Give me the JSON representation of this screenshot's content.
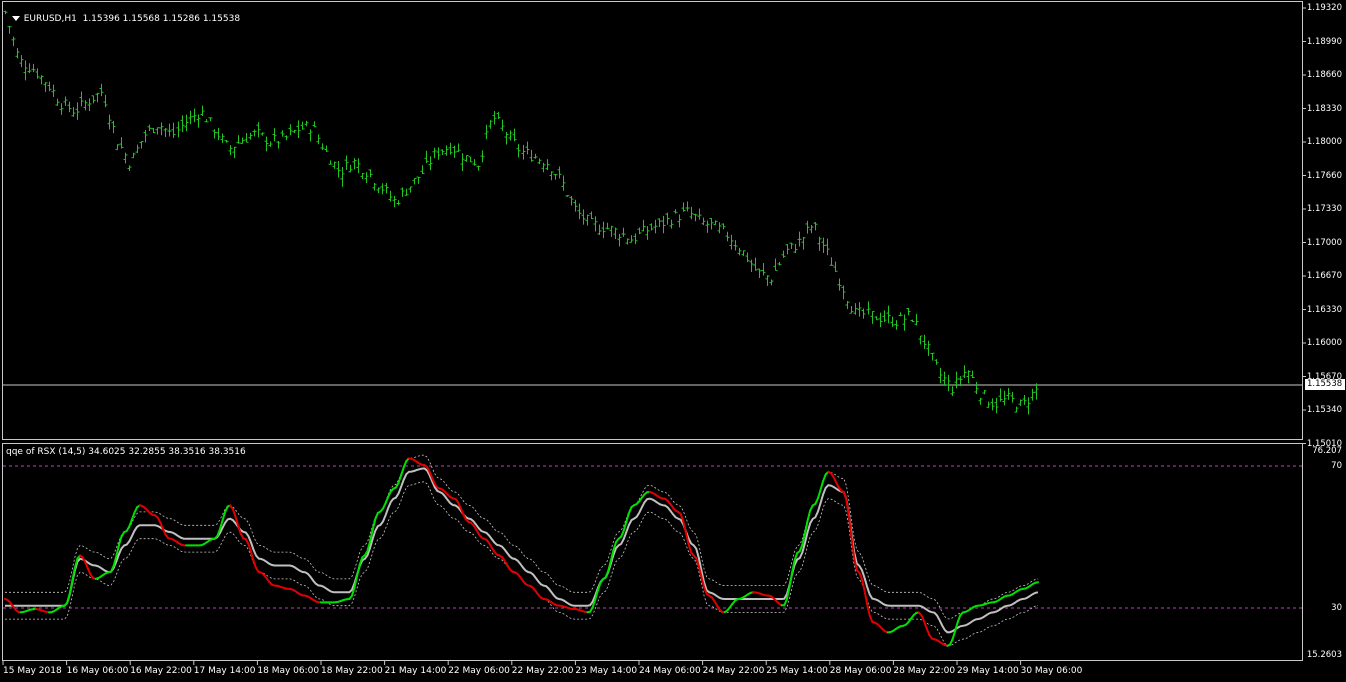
{
  "main_header": {
    "symbol": "EURUSD,H1",
    "ohlc": "1.15396 1.15568 1.15286 1.15538"
  },
  "indicator_header": {
    "text": "qqe of RSX (14,5) 34.6025 32.2855 38.3516 38.3516"
  },
  "price_axis": [
    "1.19320",
    "1.18990",
    "1.18660",
    "1.18330",
    "1.18000",
    "1.17660",
    "1.17330",
    "1.17000",
    "1.16670",
    "1.16330",
    "1.16000",
    "1.15670",
    "1.15340",
    "1.15010"
  ],
  "current_price": "1.15538",
  "indicator_axis": [
    "76.207",
    "70",
    "30",
    "15.2603"
  ],
  "time_axis": [
    "15 May 2018",
    "16 May 06:00",
    "16 May 22:00",
    "17 May 14:00",
    "18 May 06:00",
    "18 May 22:00",
    "21 May 14:00",
    "22 May 06:00",
    "22 May 22:00",
    "23 May 14:00",
    "24 May 06:00",
    "24 May 22:00",
    "25 May 14:00",
    "28 May 06:00",
    "28 May 22:00",
    "29 May 14:00",
    "30 May 06:00"
  ],
  "colors": {
    "bars": "#22c322",
    "rsx_up": "#00e000",
    "rsx_down": "#e00000",
    "signal": "#c0c0c0",
    "levels": "#c040c0",
    "grid": "#c8c8c8"
  },
  "chart_data": [
    {
      "type": "ohlc",
      "title": "EURUSD,H1",
      "ylim": [
        1.1501,
        1.1932
      ],
      "close_path": [
        1.1928,
        1.188,
        1.1872,
        1.1858,
        1.1838,
        1.183,
        1.184,
        1.185,
        1.1802,
        1.1778,
        1.1806,
        1.1818,
        1.1806,
        1.182,
        1.183,
        1.1812,
        1.1792,
        1.1802,
        1.1808,
        1.18,
        1.1802,
        1.1812,
        1.1815,
        1.179,
        1.177,
        1.178,
        1.177,
        1.1755,
        1.174,
        1.1755,
        1.177,
        1.179,
        1.1795,
        1.1785,
        1.1778,
        1.1825,
        1.1808,
        1.179,
        1.1785,
        1.1778,
        1.1758,
        1.173,
        1.1718,
        1.1715,
        1.171,
        1.1703,
        1.1712,
        1.1718,
        1.1725,
        1.173,
        1.172,
        1.1715,
        1.1706,
        1.169,
        1.167,
        1.1665,
        1.169,
        1.17,
        1.1718,
        1.169,
        1.166,
        1.163,
        1.1628,
        1.1625,
        1.1622,
        1.1628,
        1.16,
        1.157,
        1.1555,
        1.1575,
        1.155,
        1.154,
        1.1545,
        1.1538,
        1.1554
      ],
      "last": 1.15538
    },
    {
      "type": "line",
      "title": "qqe of RSX (14,5)",
      "ylim": [
        15.2603,
        76.207
      ],
      "levels": [
        70,
        30
      ],
      "series": [
        {
          "values": [
            32,
            28,
            29,
            28,
            30,
            45,
            38,
            40,
            52,
            60,
            57,
            50,
            48,
            48,
            50,
            60,
            50,
            40,
            36,
            35,
            33,
            31,
            31,
            32,
            45,
            58,
            65,
            74,
            72,
            65,
            62,
            55,
            50,
            45,
            40,
            36,
            32,
            30,
            29,
            28,
            38,
            50,
            60,
            64,
            62,
            58,
            45,
            33,
            28,
            32,
            34,
            33,
            30,
            46,
            60,
            70,
            64,
            40,
            25,
            22,
            24,
            28,
            20,
            18,
            28,
            30,
            31,
            33,
            35,
            37
          ]
        },
        {
          "values": [
            30,
            30,
            30,
            30,
            30,
            44,
            42,
            40,
            48,
            54,
            54,
            52,
            50,
            50,
            50,
            56,
            52,
            44,
            42,
            42,
            40,
            36,
            34,
            34,
            44,
            54,
            62,
            70,
            71,
            64,
            60,
            56,
            52,
            48,
            44,
            40,
            36,
            32,
            30,
            30,
            38,
            48,
            56,
            62,
            60,
            56,
            48,
            34,
            32,
            32,
            32,
            32,
            32,
            44,
            56,
            66,
            64,
            42,
            32,
            30,
            30,
            30,
            28,
            22,
            24,
            26,
            28,
            30,
            32,
            34
          ]
        }
      ]
    }
  ]
}
